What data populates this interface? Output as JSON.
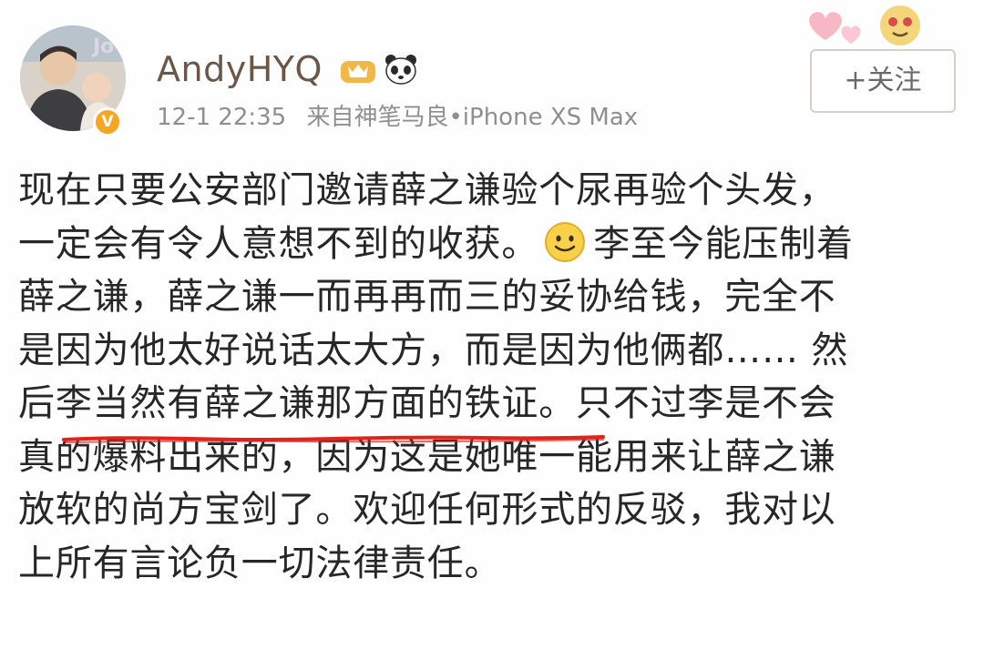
{
  "user": {
    "name": "AndyHYQ",
    "verified_badge": "V",
    "timestamp": "12-1 22:35",
    "source": "来自神笔马良•iPhone XS Max"
  },
  "follow_button": {
    "label": "+关注"
  },
  "post": {
    "lines": [
      "现在只要公安部门邀请薛之谦验个尿再验个头发，",
      "一定会有令人意想不到的收获。",
      "李至今能压制着",
      "薛之谦，薛之谦一而再再而三的妥协给钱，完全不",
      "是因为他太好说话太大方，而是因为他俩都…… 然",
      "后",
      "李当然有薛之谦那方面的铁证",
      "。只不过李是不会",
      "真的爆料出来的，因为这是她唯一能用来让薛之谦",
      "放软的尚方宝剑了。欢迎任何形式的反驳，我对以",
      "上所有言论负一切法律责任。"
    ]
  },
  "icons": {
    "emoji": "smiley-icon",
    "badges": [
      "member-crown-icon",
      "panda-icon"
    ],
    "decoration": "hearts-sticker-icon"
  },
  "colors": {
    "username": "#6b5747",
    "meta": "#8f8f8f",
    "body_text": "#272727",
    "underline": "#e0231b",
    "verified": "#f6a623"
  }
}
